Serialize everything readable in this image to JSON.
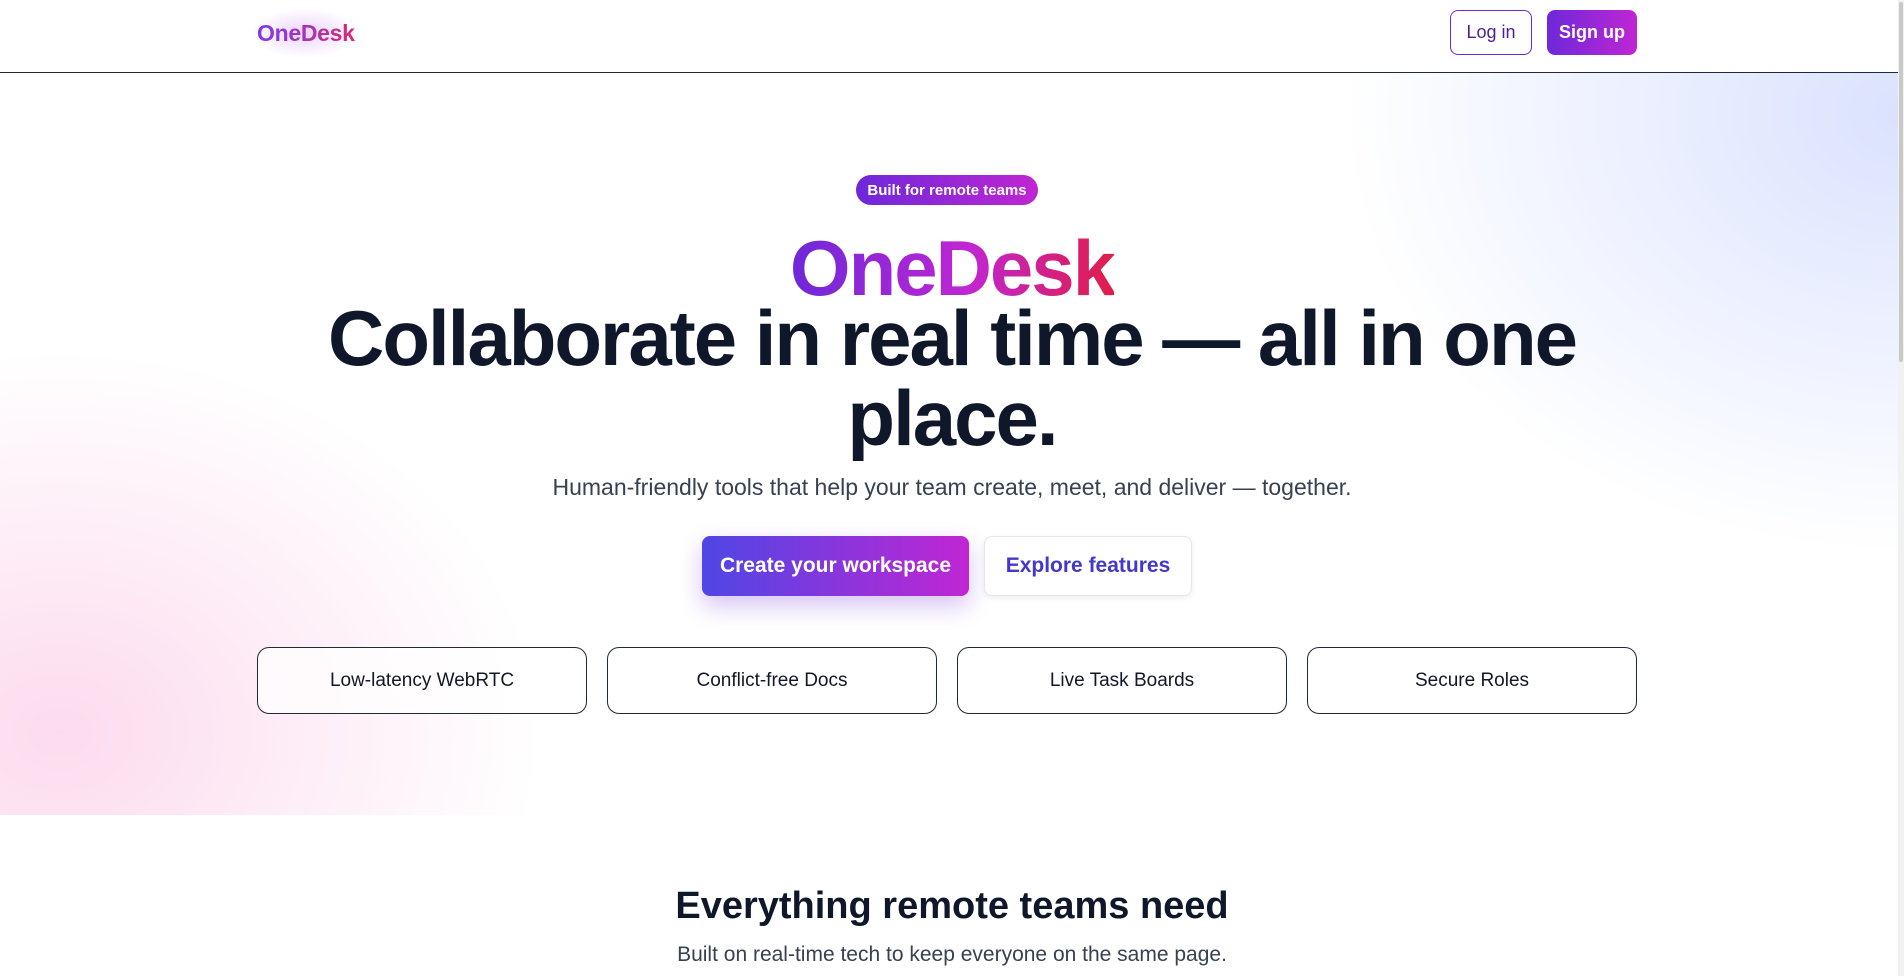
{
  "header": {
    "logo": "OneDesk",
    "login_label": "Log in",
    "signup_label": "Sign up"
  },
  "hero": {
    "badge": "Built for remote teams",
    "brand": "OneDesk",
    "headline": "Collaborate in real time — all in one place.",
    "subline": "Human-friendly tools that help your team create, meet, and deliver — together.",
    "primary_cta": "Create your workspace",
    "secondary_cta": "Explore features",
    "features": [
      "Low-latency WebRTC",
      "Conflict-free Docs",
      "Live Task Boards",
      "Secure Roles"
    ]
  },
  "section": {
    "title": "Everything remote teams need",
    "subtitle": "Built on real-time tech to keep everyone on the same page."
  },
  "colors": {
    "brand_purple": "#6d28d9",
    "brand_magenta": "#c026d3",
    "brand_red": "#e11d48",
    "text_dark": "#0f172a"
  }
}
